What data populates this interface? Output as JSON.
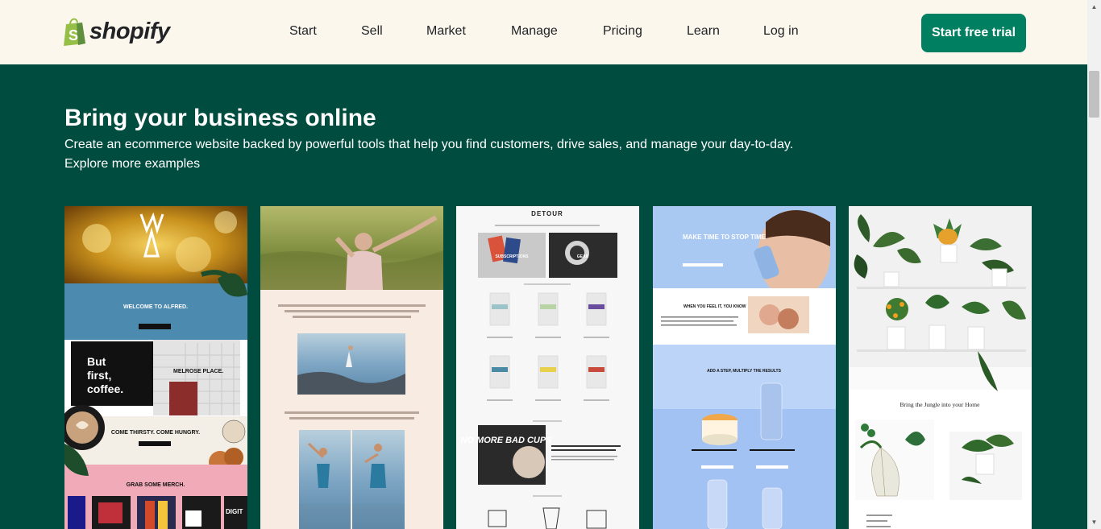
{
  "header": {
    "logo_text": "shopify",
    "nav": [
      {
        "label": "Start"
      },
      {
        "label": "Sell"
      },
      {
        "label": "Market"
      },
      {
        "label": "Manage"
      },
      {
        "label": "Pricing"
      },
      {
        "label": "Learn"
      },
      {
        "label": "Log in"
      }
    ],
    "cta_label": "Start free trial"
  },
  "hero": {
    "title": "Bring your business online",
    "subtitle": "Create an ecommerce website backed by powerful tools that help you find customers, drive sales, and manage your day-to-day.",
    "explore_link": "Explore more examples"
  },
  "examples": [
    {
      "name": "alfred",
      "texts": {
        "welcome": "WELCOME TO ALFRED.",
        "but_first": "But first, coffee.",
        "melrose": "MELROSE PLACE.",
        "thirsty": "COME THIRSTY. COME HUNGRY.",
        "merch": "GRAB SOME MERCH."
      }
    },
    {
      "name": "yoga-studio",
      "texts": {}
    },
    {
      "name": "detour",
      "texts": {
        "brand": "DETOUR",
        "subscriptions": "SUBSCRIPTIONS",
        "gear": "GEAR",
        "no_more": "NO MORE BAD CUPS"
      }
    },
    {
      "name": "skincare",
      "texts": {
        "make_time": "MAKE TIME TO STOP TIME",
        "when_you_feel": "WHEN YOU FEEL IT, YOU KNOW",
        "add_a_step": "ADD A STEP, MULTIPLY THE RESULTS"
      }
    },
    {
      "name": "plants",
      "texts": {
        "tagline": "Bring the Jungle into your Home"
      }
    }
  ],
  "colors": {
    "header_bg": "#fbf7ed",
    "main_bg": "#004c3f",
    "cta_bg": "#008060",
    "brand_green": "#95bf47"
  }
}
